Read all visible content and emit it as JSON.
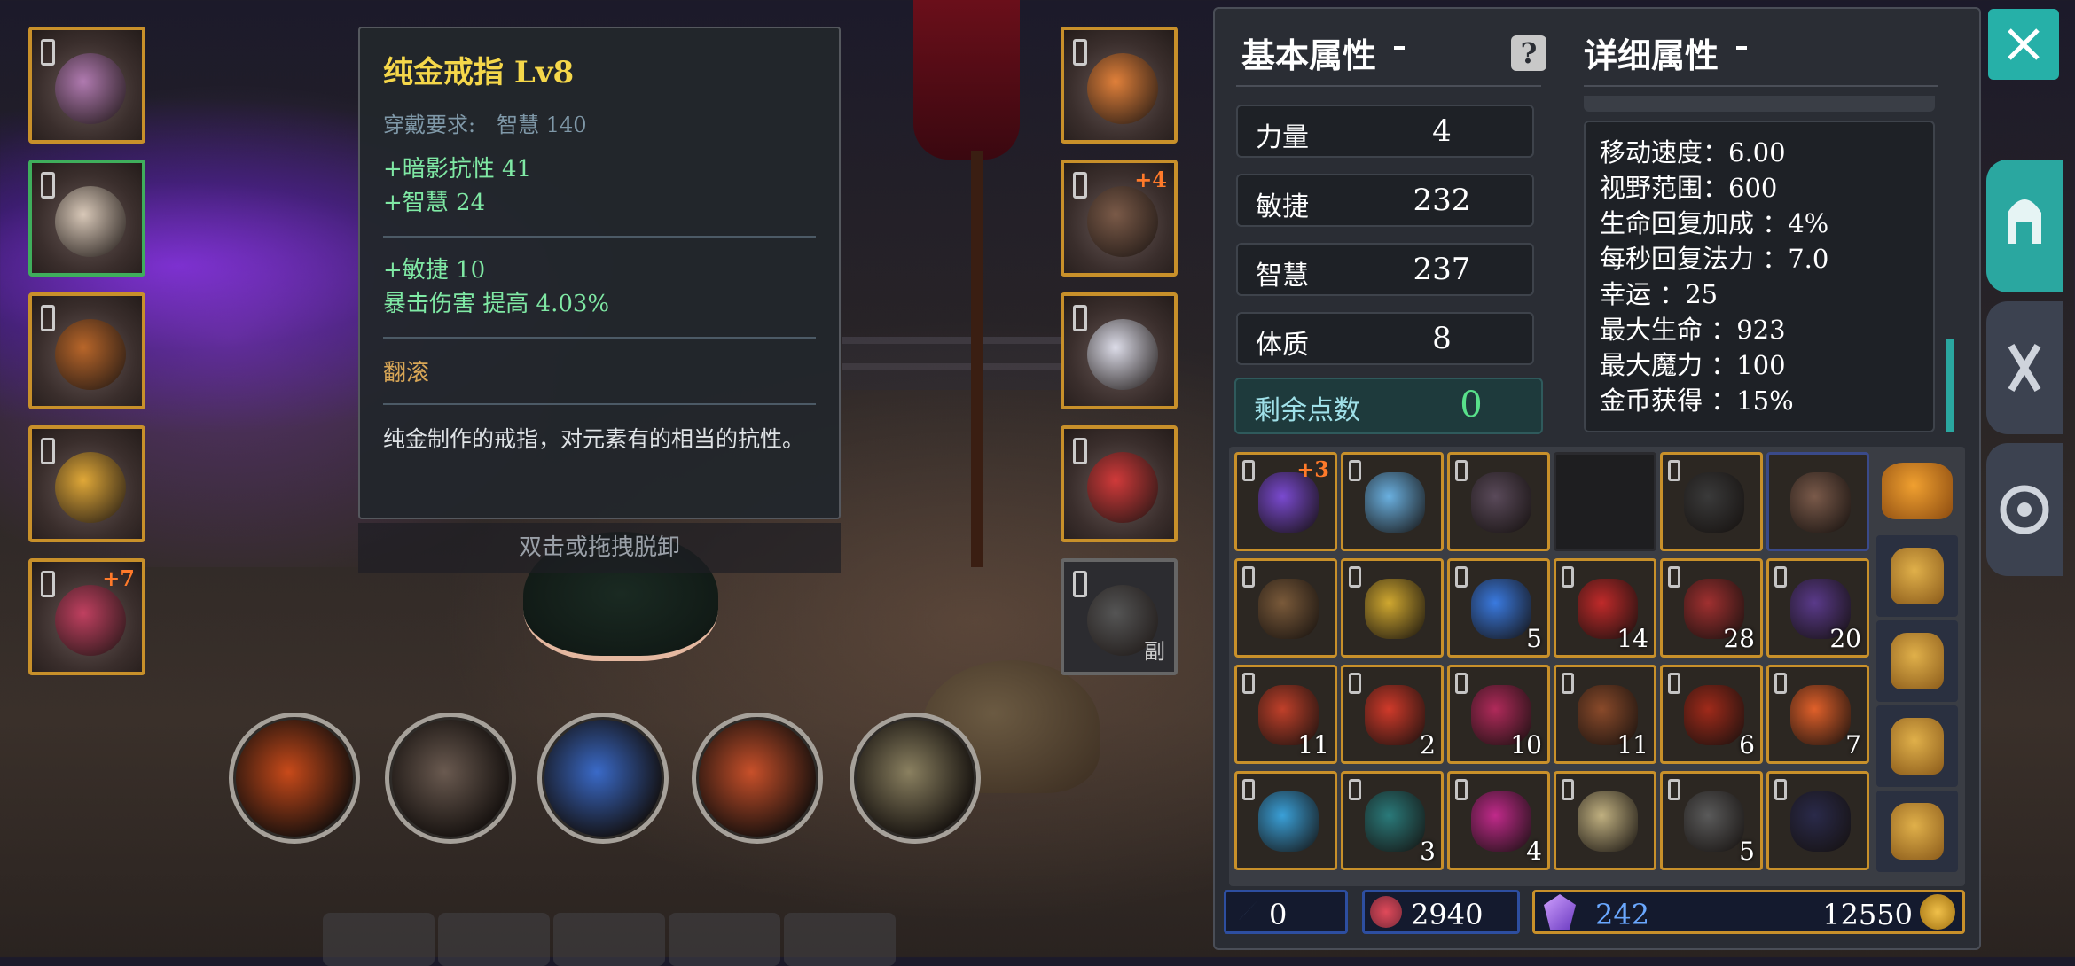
{
  "tooltip": {
    "title": "纯金戒指  Lv8",
    "req_label": "穿戴要求:",
    "req_value": "智慧 140",
    "base_stats": [
      "+暗影抗性 41",
      "+智慧 24"
    ],
    "extra_stats": [
      "+敏捷 10",
      "暴击伤害 提高 4.03%"
    ],
    "skill": "翻滚",
    "description": "纯金制作的戒指，对元素有的相当的抗性。"
  },
  "hint": "双击或拖拽脱卸",
  "equipment_left": [
    {
      "icon": "helmet-icon",
      "plus": "",
      "color": "#b07ab0"
    },
    {
      "icon": "armor-icon",
      "plus": "",
      "color": "#d8c8b8"
    },
    {
      "icon": "belt-icon",
      "plus": "",
      "color": "#b8662a"
    },
    {
      "icon": "ring-icon",
      "plus": "",
      "color": "#e0a838"
    },
    {
      "icon": "staff-icon",
      "plus": "+7",
      "color": "#c04060"
    }
  ],
  "equipment_right": [
    {
      "icon": "necklace-icon",
      "plus": "",
      "color": "#e0803a"
    },
    {
      "icon": "gloves-icon",
      "plus": "+4",
      "color": "#7a5a48"
    },
    {
      "icon": "boots-icon",
      "plus": "",
      "color": "#dcdce8"
    },
    {
      "icon": "red-ring-icon",
      "plus": "",
      "color": "#d03a3a"
    },
    {
      "icon": "sword-icon",
      "plus": "",
      "sub": "副",
      "color": "#555555"
    }
  ],
  "skills": [
    {
      "icon": "meteor-skill-icon",
      "color": "#c84a1a"
    },
    {
      "icon": "claw-skill-icon",
      "color": "#6a5a50"
    },
    {
      "icon": "lightning-orb-skill-icon",
      "color": "#3a6ac8"
    },
    {
      "icon": "fireball-skill-icon",
      "color": "#c8502a"
    },
    {
      "icon": "vortex-skill-icon",
      "color": "#8a8060"
    }
  ],
  "panel": {
    "basic_title": "基本属性",
    "detail_title": "详细属性",
    "help": "?",
    "stats": [
      {
        "label": "力量",
        "value": "4"
      },
      {
        "label": "敏捷",
        "value": "232"
      },
      {
        "label": "智慧",
        "value": "237"
      },
      {
        "label": "体质",
        "value": "8"
      }
    ],
    "remain_label": "剩余点数",
    "remain_value": "0",
    "details": [
      "移动速度：6.00",
      "视野范围：600",
      "生命回复加成 ：4%",
      "每秒回复法力 ：7.0",
      "幸运 ：25",
      "最大生命 ：923",
      "最大魔力 ：100",
      "金币获得 ：15%"
    ]
  },
  "inventory": [
    [
      {
        "icon": "amulet-icon",
        "count": "",
        "plus": "+3",
        "color": "#7a4ad0",
        "blue": false
      },
      {
        "icon": "crystal-ring-icon",
        "count": "",
        "plus": "",
        "color": "#6ab0e0",
        "blue": false
      },
      {
        "icon": "leather-armor-icon",
        "count": "",
        "plus": "",
        "color": "#5a4a5a",
        "blue": false
      },
      {
        "icon": "empty-slot",
        "count": "",
        "plus": "",
        "color": "#222222",
        "blue": false
      },
      {
        "icon": "dagger-icon",
        "count": "",
        "plus": "",
        "color": "#3a3a3a",
        "blue": false
      },
      {
        "icon": "leather-boots-icon",
        "count": "",
        "plus": "",
        "color": "#7a5a4a",
        "blue": true
      }
    ],
    [
      {
        "icon": "shield-icon",
        "count": "",
        "plus": "",
        "color": "#7a5a3a",
        "blue": false
      },
      {
        "icon": "scroll-icon",
        "count": "",
        "plus": "",
        "color": "#d0a830",
        "blue": false
      },
      {
        "icon": "blue-orb-icon",
        "count": "5",
        "plus": "",
        "color": "#3a7ae0",
        "blue": false
      },
      {
        "icon": "red-crystal-icon",
        "count": "14",
        "plus": "",
        "color": "#c02a2a",
        "blue": false
      },
      {
        "icon": "red-ore-icon",
        "count": "28",
        "plus": "",
        "color": "#a03030",
        "blue": false
      },
      {
        "icon": "purple-ore-icon",
        "count": "20",
        "plus": "",
        "color": "#5a3a8a",
        "blue": false
      }
    ],
    [
      {
        "icon": "red-gem-icon",
        "count": "11",
        "plus": "",
        "color": "#c0402a",
        "blue": false
      },
      {
        "icon": "red-shard-icon",
        "count": "2",
        "plus": "",
        "color": "#d03a2a",
        "blue": false
      },
      {
        "icon": "pink-stone-icon",
        "count": "10",
        "plus": "",
        "color": "#b02a5a",
        "blue": false
      },
      {
        "icon": "wood-icon",
        "count": "11",
        "plus": "",
        "color": "#8a4a2a",
        "blue": false
      },
      {
        "icon": "red-feather-icon",
        "count": "6",
        "plus": "",
        "color": "#a02a1a",
        "blue": false
      },
      {
        "icon": "fire-crystal-icon",
        "count": "7",
        "plus": "",
        "color": "#e0602a",
        "blue": false
      }
    ],
    [
      {
        "icon": "ice-crystal-icon",
        "count": "",
        "plus": "",
        "color": "#3aa0d8",
        "blue": false
      },
      {
        "icon": "teal-shards-icon",
        "count": "3",
        "plus": "",
        "color": "#2a7a7a",
        "blue": false
      },
      {
        "icon": "magenta-orb-icon",
        "count": "4",
        "plus": "",
        "color": "#c02a8a",
        "blue": false
      },
      {
        "icon": "eye-orb-icon",
        "count": "",
        "plus": "",
        "color": "#c0b080",
        "blue": false
      },
      {
        "icon": "stone-icon",
        "count": "5",
        "plus": "",
        "color": "#5a5a5a",
        "blue": false
      },
      {
        "icon": "dark-scale-icon",
        "count": "",
        "plus": "",
        "color": "#2a2a4a",
        "blue": false
      }
    ]
  ],
  "bags": [
    "bag-icon",
    "bag-icon",
    "bag-icon",
    "bag-icon",
    "bag-icon"
  ],
  "currency": {
    "wand": "0",
    "hearts": "2940",
    "gems": "242",
    "gold": "12550"
  },
  "sidebar": [
    "helmet-tab-icon",
    "gloves-tab-icon",
    "settings-tab-icon"
  ]
}
